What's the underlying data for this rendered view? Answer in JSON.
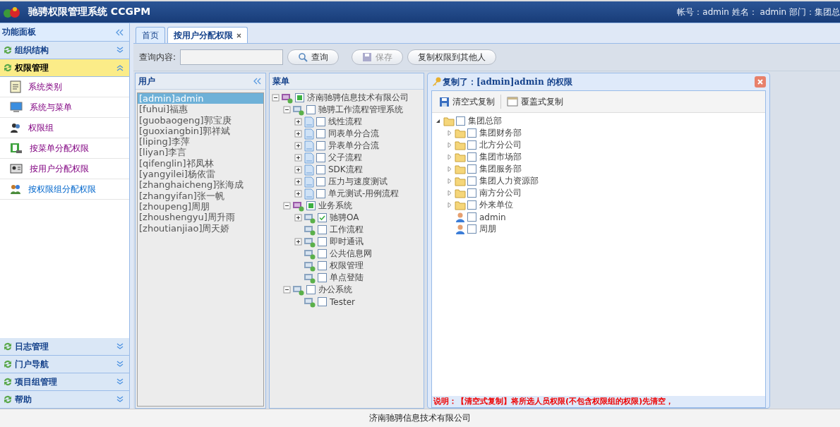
{
  "header": {
    "title": "驰骋权限管理系统 CCGPM",
    "user_info": "帐号：admin 姓名： admin 部门：集团总"
  },
  "sidebar": {
    "title": "功能面板",
    "groups_top": [
      {
        "label": "组织结构",
        "expanded": false
      },
      {
        "label": "权限管理",
        "expanded": true,
        "items": [
          {
            "label": "系统类别",
            "kind": "doc",
            "visited": true
          },
          {
            "label": "系统与菜单",
            "kind": "monitor",
            "visited": true
          },
          {
            "label": "权限组",
            "kind": "group",
            "visited": true
          },
          {
            "label": "按菜单分配权限",
            "kind": "board",
            "visited": true
          },
          {
            "label": "按用户分配权限",
            "kind": "card",
            "visited": true
          },
          {
            "label": "按权限组分配权限",
            "kind": "people",
            "visited": false
          }
        ]
      }
    ],
    "groups_bottom": [
      {
        "label": "日志管理",
        "expanded": false
      },
      {
        "label": "门户导航",
        "expanded": false
      },
      {
        "label": "项目组管理",
        "expanded": false
      },
      {
        "label": "帮助",
        "expanded": false
      }
    ]
  },
  "tabs": [
    {
      "label": "首页",
      "selected": false,
      "closable": false
    },
    {
      "label": "按用户分配权限",
      "selected": true,
      "closable": true
    }
  ],
  "toolbar": {
    "query_label": "查询内容:",
    "query_button": "查询",
    "save_button": "保存",
    "save_disabled": true,
    "copy_button": "复制权限到其他人"
  },
  "users_panel": {
    "title": "用户",
    "users": [
      {
        "label": "[admin]admin",
        "selected": true
      },
      {
        "label": "[fuhui]福惠",
        "selected": false
      },
      {
        "label": "[guobaogeng]郭宝庚",
        "selected": false
      },
      {
        "label": "[guoxiangbin]郭祥斌",
        "selected": false
      },
      {
        "label": "[liping]李萍",
        "selected": false
      },
      {
        "label": "[liyan]李言",
        "selected": false
      },
      {
        "label": "[qifenglin]祁凤林",
        "selected": false
      },
      {
        "label": "[yangyilei]杨依雷",
        "selected": false
      },
      {
        "label": "[zhanghaicheng]张海成",
        "selected": false
      },
      {
        "label": "[zhangyifan]张一帆",
        "selected": false
      },
      {
        "label": "[zhoupeng]周朋",
        "selected": false
      },
      {
        "label": "[zhoushengyu]周升雨",
        "selected": false
      },
      {
        "label": "[zhoutianjiao]周天娇",
        "selected": false
      }
    ]
  },
  "menu_panel": {
    "title": "菜单",
    "tree": [
      {
        "label": "济南驰骋信息技术有限公司",
        "kind": "org",
        "expanded": true,
        "partial": true,
        "children": [
          {
            "label": "驰骋工作流程管理系统",
            "kind": "system",
            "expanded": true,
            "checked": false,
            "children": [
              {
                "label": "线性流程",
                "kind": "page",
                "expanded": false,
                "checked": false
              },
              {
                "label": "同表单分合流",
                "kind": "page",
                "expanded": false,
                "checked": false
              },
              {
                "label": "异表单分合流",
                "kind": "page",
                "expanded": false,
                "checked": false
              },
              {
                "label": "父子流程",
                "kind": "page",
                "expanded": false,
                "checked": false
              },
              {
                "label": "SDK流程",
                "kind": "page",
                "expanded": false,
                "checked": false
              },
              {
                "label": "压力与速度测试",
                "kind": "page",
                "expanded": false,
                "checked": false
              },
              {
                "label": "单元测试-用例流程",
                "kind": "page",
                "expanded": false,
                "checked": false
              }
            ]
          },
          {
            "label": "业务系统",
            "kind": "org",
            "expanded": true,
            "partial": true,
            "children": [
              {
                "label": "驰骋OA",
                "kind": "system",
                "expanded": false,
                "checked": true
              },
              {
                "label": "工作流程",
                "kind": "system",
                "checked": false
              },
              {
                "label": "即时通讯",
                "kind": "system",
                "expanded": false,
                "checked": false
              },
              {
                "label": "公共信息网",
                "kind": "system",
                "checked": false
              },
              {
                "label": "权限管理",
                "kind": "system",
                "checked": false
              },
              {
                "label": "单点登陆",
                "kind": "system",
                "checked": false
              }
            ]
          },
          {
            "label": "办公系统",
            "kind": "system",
            "expanded": true,
            "checked": false,
            "children": [
              {
                "label": "Tester",
                "kind": "system",
                "checked": false
              }
            ]
          }
        ]
      }
    ]
  },
  "dialog": {
    "title": "复制了：[admin]admin 的权限",
    "buttons": [
      {
        "label": "清空式复制",
        "kind": "save"
      },
      {
        "label": "覆盖式复制",
        "kind": "window"
      }
    ],
    "tree": [
      {
        "label": "集团总部",
        "kind": "folder",
        "expanded": true,
        "checked": false,
        "children": [
          {
            "label": "集团财务部",
            "kind": "folder",
            "expanded": false,
            "checked": false
          },
          {
            "label": "北方分公司",
            "kind": "folder",
            "expanded": false,
            "checked": false
          },
          {
            "label": "集团市场部",
            "kind": "folder",
            "expanded": false,
            "checked": false
          },
          {
            "label": "集团服务部",
            "kind": "folder",
            "expanded": false,
            "checked": false
          },
          {
            "label": "集团人力资源部",
            "kind": "folder",
            "expanded": false,
            "checked": false
          },
          {
            "label": "南方分公司",
            "kind": "folder",
            "expanded": false,
            "checked": false
          },
          {
            "label": "外来单位",
            "kind": "folder",
            "expanded": false,
            "checked": false
          },
          {
            "label": "admin",
            "kind": "user",
            "checked": false
          },
          {
            "label": "周朋",
            "kind": "user",
            "checked": false
          }
        ]
      }
    ],
    "note": "说明：【清空式复制】将所选人员权限(不包含权限组的权限)先清空，"
  },
  "footer": "济南驰骋信息技术有限公司"
}
